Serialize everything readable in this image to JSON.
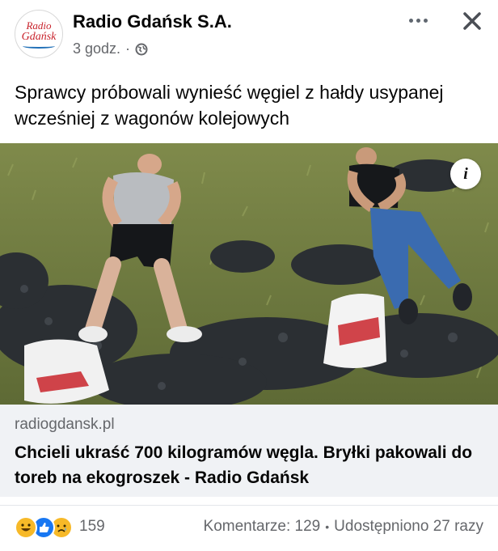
{
  "post": {
    "page_name": "Radio Gdańsk S.A.",
    "avatar_line1": "Radio",
    "avatar_line2": "Gdańsk",
    "time": "3 godz.",
    "separator": "·",
    "audience_icon": "globe-icon",
    "text": "Sprawcy próbowali wynieść węgiel z hałdy usypanej wcześniej z wagonów kolejowych"
  },
  "actions": {
    "more_icon": "more-dots-icon",
    "close_icon": "close-icon",
    "info_label": "i"
  },
  "link": {
    "domain": "radiogdansk.pl",
    "headline": "Chcieli ukraść 700 kilogramów węgla. Bryłki pakowali do toreb na ekogroszek - Radio Gdańsk"
  },
  "footer": {
    "reactions": [
      "haha",
      "like",
      "sad"
    ],
    "reaction_count": "159",
    "comments": "Komentarze: 129",
    "separator": "•",
    "shares": "Udostępniono 27 razy"
  },
  "colors": {
    "text": "#050505",
    "secondary": "#65676b",
    "link_bg": "#f0f2f5",
    "like_blue": "#1877f2",
    "haha_yellow": "#f7b928",
    "brand_red": "#c8232c"
  }
}
